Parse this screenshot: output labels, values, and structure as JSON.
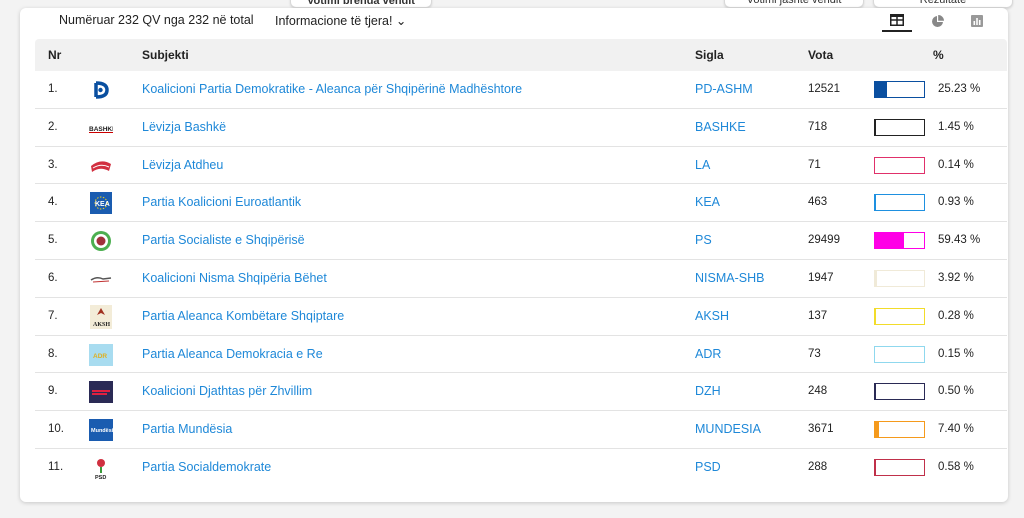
{
  "top_buttons": {
    "inside": "Votimi brenda vendit",
    "outside": "Votimi jashtë vendit",
    "results": "Rezultate"
  },
  "toolbar": {
    "count_text": "Numëruar 232 QV nga 232 në total",
    "more_info": "Informacione të tjera! ⌄",
    "views": [
      "table-icon",
      "pie-chart-icon",
      "bar-chart-icon"
    ]
  },
  "table": {
    "headers": {
      "nr": "Nr",
      "subject": "Subjekti",
      "sigla": "Sigla",
      "votes": "Vota",
      "percent": "%"
    },
    "rows": [
      {
        "nr": "1.",
        "subject": "Koalicioni Partia Demokratike - Aleanca për Shqipërinë Madhështore",
        "sigla": "PD-ASHM",
        "votes": "12521",
        "percent": "25.23 %",
        "share": 0.2523,
        "color": "#0a4fa0",
        "logo": "pd-logo"
      },
      {
        "nr": "2.",
        "subject": "Lëvizja Bashkë",
        "sigla": "BASHKE",
        "votes": "718",
        "percent": "1.45 %",
        "share": 0.0145,
        "color": "#222222",
        "logo": "bashke-logo"
      },
      {
        "nr": "3.",
        "subject": "Lëvizja Atdheu",
        "sigla": "LA",
        "votes": "71",
        "percent": "0.14 %",
        "share": 0.0014,
        "color": "#e0306a",
        "logo": "la-logo"
      },
      {
        "nr": "4.",
        "subject": "Partia Koalicioni Euroatlantik",
        "sigla": "KEA",
        "votes": "463",
        "percent": "0.93 %",
        "share": 0.0093,
        "color": "#1e90e0",
        "logo": "kea-logo"
      },
      {
        "nr": "5.",
        "subject": "Partia Socialiste e Shqipërisë",
        "sigla": "PS",
        "votes": "29499",
        "percent": "59.43 %",
        "share": 0.5943,
        "color": "#ff00e6",
        "logo": "ps-logo"
      },
      {
        "nr": "6.",
        "subject": "Koalicioni Nisma Shqipëria Bëhet",
        "sigla": "NISMA-SHB",
        "votes": "1947",
        "percent": "3.92 %",
        "share": 0.0392,
        "color": "#f0ead8",
        "logo": "nisma-logo"
      },
      {
        "nr": "7.",
        "subject": "Partia Aleanca Kombëtare Shqiptare",
        "sigla": "AKSH",
        "votes": "137",
        "percent": "0.28 %",
        "share": 0.0028,
        "color": "#f2dc2a",
        "logo": "aksh-logo"
      },
      {
        "nr": "8.",
        "subject": "Partia Aleanca Demokracia e Re",
        "sigla": "ADR",
        "votes": "73",
        "percent": "0.15 %",
        "share": 0.0015,
        "color": "#8fd8ee",
        "logo": "adr-logo"
      },
      {
        "nr": "9.",
        "subject": "Koalicioni Djathtas për Zhvillim",
        "sigla": "DZH",
        "votes": "248",
        "percent": "0.50 %",
        "share": 0.005,
        "color": "#2a2a55",
        "logo": "dzh-logo"
      },
      {
        "nr": "10.",
        "subject": "Partia Mundësia",
        "sigla": "MUNDESIA",
        "votes": "3671",
        "percent": "7.40 %",
        "share": 0.074,
        "color": "#f59a1c",
        "logo": "mundesia-logo"
      },
      {
        "nr": "11.",
        "subject": "Partia Socialdemokrate",
        "sigla": "PSD",
        "votes": "288",
        "percent": "0.58 %",
        "share": 0.0058,
        "color": "#c0304a",
        "logo": "psd-logo"
      }
    ]
  }
}
